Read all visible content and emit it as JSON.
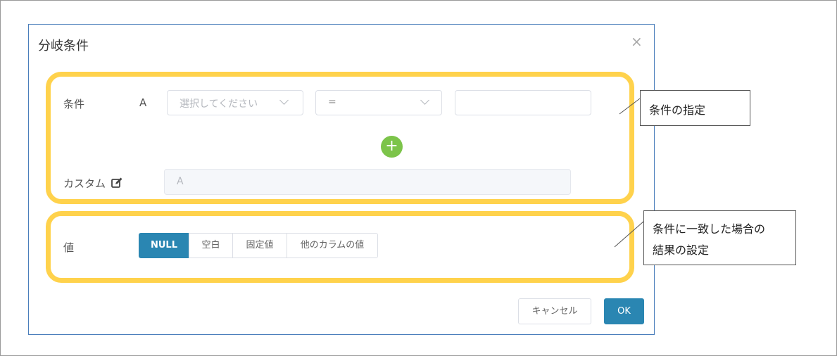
{
  "dialog": {
    "title": "分岐条件",
    "close_glyph": "×"
  },
  "condition": {
    "label": "条件",
    "variable": "A",
    "select_placeholder": "選択してください",
    "operator": "=",
    "value": ""
  },
  "custom": {
    "label": "カスタム",
    "value": "A"
  },
  "value_section": {
    "label": "値",
    "options": [
      "NULL",
      "空白",
      "固定値",
      "他のカラムの値"
    ],
    "selected": "NULL"
  },
  "footer": {
    "cancel_label": "キャンセル",
    "ok_label": "OK"
  },
  "annotations": {
    "condition_callout": "条件の指定",
    "value_callout_line1": "条件に一致した場合の",
    "value_callout_line2": "結果の設定"
  },
  "icons": {
    "add": "plus-icon",
    "edit": "edit-icon",
    "close": "close-icon",
    "dropdown": "chevron-down-icon"
  },
  "colors": {
    "highlight": "#ffd24c",
    "primary": "#2a86b2",
    "add_button": "#7cc44a",
    "dialog_border": "#4a7ebb"
  }
}
